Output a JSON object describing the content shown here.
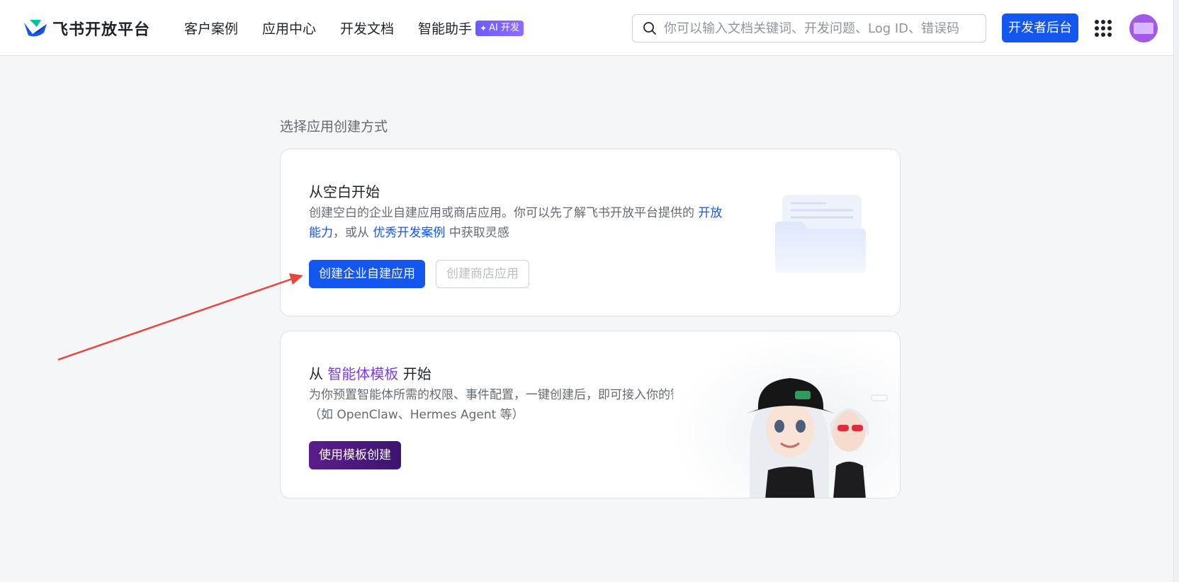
{
  "header": {
    "logo_text": "飞书开放平台",
    "nav": [
      "客户案例",
      "应用中心",
      "开发文档",
      "智能助手"
    ],
    "ai_badge": "AI 开发",
    "search_placeholder": "你可以输入文档关键词、开发问题、Log ID、错误码",
    "console_button": "开发者后台"
  },
  "main": {
    "section_title": "选择应用创建方式",
    "blank_card": {
      "title": "从空白开始",
      "desc_prefix": "创建空白的企业自建应用或商店应用。你可以先了解飞书开放平台提供的 ",
      "desc_link1": "开放能力",
      "desc_mid": "，或从 ",
      "desc_link2": "优秀开发案例",
      "desc_suffix": " 中获取灵感",
      "primary_button": "创建企业自建应用",
      "secondary_button": "创建商店应用"
    },
    "template_card": {
      "title_prefix": "从 ",
      "title_highlight": "智能体模板",
      "title_suffix": " 开始",
      "desc": "为你预置智能体所需的权限、事件配置，一键创建后，即可接入你的智能体服务（如 OpenClaw、Hermes Agent 等）",
      "button": "使用模板创建"
    }
  },
  "colors": {
    "primary": "#1456f0",
    "purple": "#7a3eea",
    "template_button": "#4a1a7e",
    "annotation_arrow": "#e8453c"
  }
}
